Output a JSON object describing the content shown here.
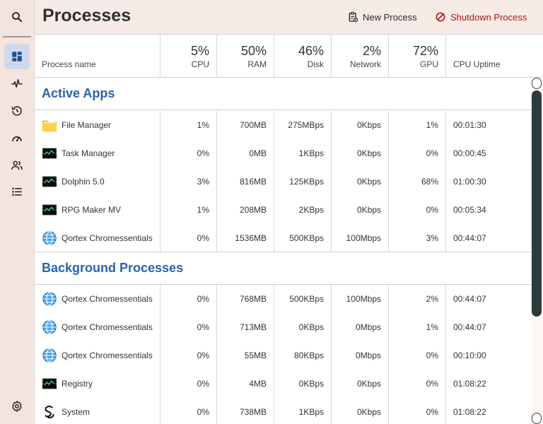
{
  "header": {
    "title": "Processes",
    "new_process": "New Process",
    "shutdown_process": "Shutdown Process"
  },
  "sidebar": {
    "items": [
      {
        "icon": "search-icon"
      },
      {
        "icon": "dashboard-icon",
        "active": true
      },
      {
        "icon": "activity-icon"
      },
      {
        "icon": "history-icon"
      },
      {
        "icon": "speedometer-icon"
      },
      {
        "icon": "users-icon"
      },
      {
        "icon": "list-icon"
      },
      {
        "icon": "gear-icon"
      }
    ]
  },
  "columns": {
    "name": "Process name",
    "cpu": {
      "pct": "5%",
      "label": "CPU"
    },
    "ram": {
      "pct": "50%",
      "label": "RAM"
    },
    "disk": {
      "pct": "46%",
      "label": "Disk"
    },
    "network": {
      "pct": "2%",
      "label": "Network"
    },
    "gpu": {
      "pct": "72%",
      "label": "GPU"
    },
    "uptime": "CPU Uptime"
  },
  "sections": {
    "active": {
      "title": "Active Apps",
      "rows": [
        {
          "icon": "folder-icon",
          "name": "File Manager",
          "cpu": "1%",
          "ram": "700MB",
          "disk": "275MBps",
          "net": "0Kbps",
          "gpu": "1%",
          "uptime": "00:01:30"
        },
        {
          "icon": "terminal-icon",
          "name": "Task Manager",
          "cpu": "0%",
          "ram": "0MB",
          "disk": "1KBps",
          "net": "0Kbps",
          "gpu": "0%",
          "uptime": "00:00:45"
        },
        {
          "icon": "terminal-icon",
          "name": "Dolphin 5.0",
          "cpu": "3%",
          "ram": "816MB",
          "disk": "125KBps",
          "net": "0Kbps",
          "gpu": "68%",
          "uptime": "01:00:30"
        },
        {
          "icon": "terminal-icon",
          "name": "RPG Maker MV",
          "cpu": "1%",
          "ram": "208MB",
          "disk": "2KBps",
          "net": "0Kbps",
          "gpu": "0%",
          "uptime": "00:05:34"
        },
        {
          "icon": "globe-icon",
          "name": "Qortex Chromessentials",
          "cpu": "0%",
          "ram": "1536MB",
          "disk": "500KBps",
          "net": "100Mbps",
          "gpu": "3%",
          "uptime": "00:44:07"
        }
      ]
    },
    "background": {
      "title": "Background Processes",
      "rows": [
        {
          "icon": "globe-icon",
          "name": "Qortex Chromessentials",
          "cpu": "0%",
          "ram": "768MB",
          "disk": "500KBps",
          "net": "100Mbps",
          "gpu": "2%",
          "uptime": "00:44:07"
        },
        {
          "icon": "globe-icon",
          "name": "Qortex Chromessentials",
          "cpu": "0%",
          "ram": "713MB",
          "disk": "0KBps",
          "net": "0Mbps",
          "gpu": "1%",
          "uptime": "00:44:07"
        },
        {
          "icon": "globe-icon",
          "name": "Qortex Chromessentials",
          "cpu": "0%",
          "ram": "55MB",
          "disk": "80KBps",
          "net": "0Mbps",
          "gpu": "0%",
          "uptime": "00:10:00"
        },
        {
          "icon": "terminal-icon",
          "name": "Registry",
          "cpu": "0%",
          "ram": "4MB",
          "disk": "0KBps",
          "net": "0Kbps",
          "gpu": "0%",
          "uptime": "01:08:22"
        },
        {
          "icon": "system-icon",
          "name": "System",
          "cpu": "0%",
          "ram": "738MB",
          "disk": "1KBps",
          "net": "0Kbps",
          "gpu": "0%",
          "uptime": "01:08:22"
        }
      ]
    }
  },
  "colors": {
    "accent": "#2764b0",
    "danger": "#b01515",
    "sidebar_bg": "#f3e4dd",
    "header_bg": "#f6ebe6"
  }
}
